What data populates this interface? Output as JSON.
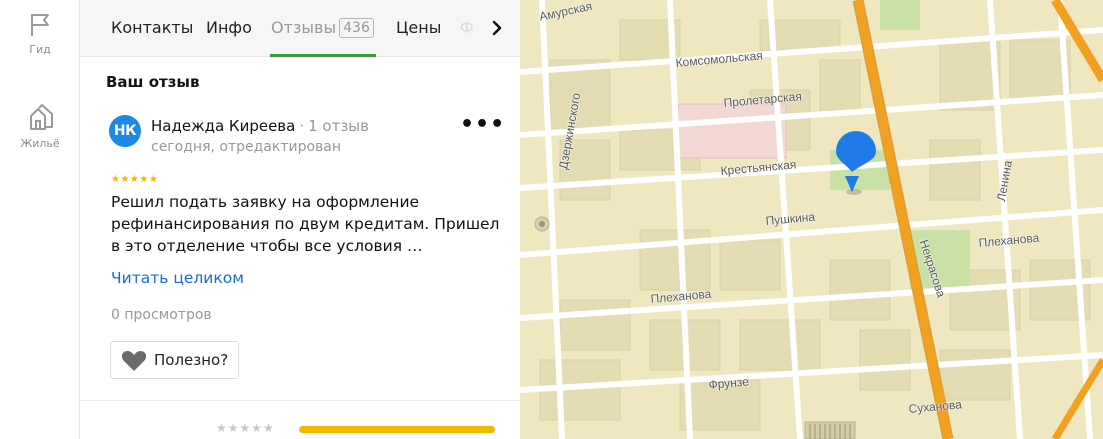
{
  "rail": {
    "guide_label": "Гид",
    "housing_label": "Жильё"
  },
  "tabs": {
    "contacts": "Контакты",
    "info": "Инфо",
    "reviews": "Отзывы",
    "reviews_count": "436",
    "prices": "Цены",
    "photos_partial": "Ф",
    "next_icon": "chevron-right-icon"
  },
  "review": {
    "section_title": "Ваш отзыв",
    "avatar_initials": "НК",
    "avatar_color": "#1e88e5",
    "author_name": "Надежда Киреева",
    "author_reviews": "1 отзыв",
    "meta": "сегодня, отредактирован",
    "rating_stars": "★★★★★",
    "rating": 5,
    "text": "Решил подать заявку на оформление рефинансирования по двум кредитам. Пришел в это отделение чтобы все условия …",
    "read_more": "Читать целиком",
    "views": "0 просмотров",
    "helpful_label": "Полезно?",
    "more_icon": "•••"
  },
  "rating_summary": {
    "stars": "★★★★★",
    "bar_color": "#f5b800"
  },
  "map": {
    "streets": {
      "amurskaya": "Амурская",
      "komsomolskaya": "Комсомольская",
      "proletarskaya": "Пролетарская",
      "dzerzhinskogo": "Дзержинского",
      "krestyanskaya": "Крестьянская",
      "pushkina": "Пушкина",
      "lenina": "Ленина",
      "plekhanova_right": "Плеханова",
      "nekrasova": "Некрасова",
      "plekhanova_left": "Плеханова",
      "frunze": "Фрунзе",
      "sukhanova": "Суханова"
    },
    "pin_color": "#1e7be8",
    "highway_color": "#f2a020"
  }
}
